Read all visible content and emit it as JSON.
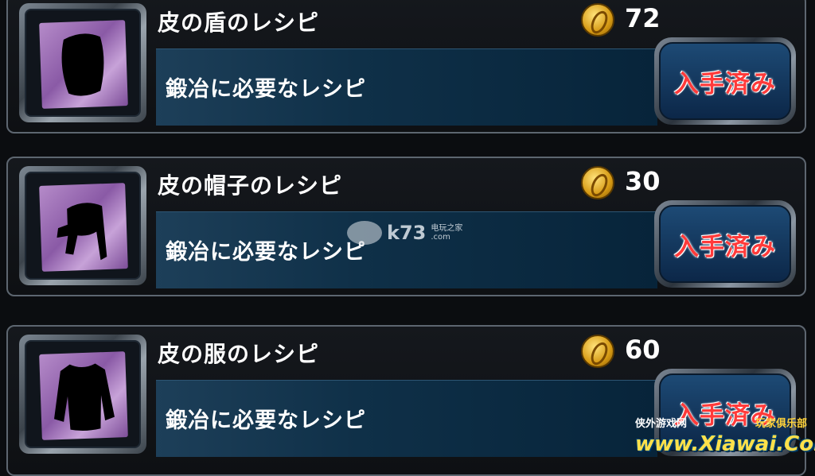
{
  "recipes": [
    {
      "name": "皮の盾のレシピ",
      "cost": "72",
      "description": "鍛冶に必要なレシピ",
      "button_label": "入手済み",
      "icon": "shield-silhouette-icon"
    },
    {
      "name": "皮の帽子のレシピ",
      "cost": "30",
      "description": "鍛冶に必要なレシピ",
      "button_label": "入手済み",
      "icon": "hat-silhouette-icon"
    },
    {
      "name": "皮の服のレシピ",
      "cost": "60",
      "description": "鍛冶に必要なレシピ",
      "button_label": "入手済み",
      "icon": "clothes-silhouette-icon"
    }
  ],
  "watermarks": {
    "k73": "k73",
    "k73_sub1": "电玩之家",
    "k73_sub2": ".com",
    "xiawai_left": "侠外游戏网",
    "xiawai_right": "玩家俱乐部",
    "xiawai_main": "www.Xiawai.Com"
  },
  "colors": {
    "button_text": "#ff3a3a",
    "desc_bar": "#0f3048",
    "coin": "#d69a14"
  }
}
